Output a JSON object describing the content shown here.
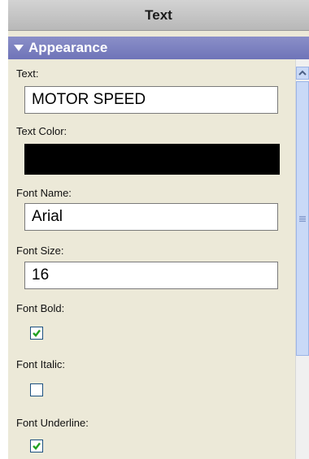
{
  "panel": {
    "title": "Text",
    "section": {
      "label": "Appearance",
      "expanded": true
    }
  },
  "fields": {
    "text": {
      "label": "Text:",
      "value": "MOTOR SPEED"
    },
    "text_color": {
      "label": "Text Color:",
      "value": "#000000"
    },
    "font_name": {
      "label": "Font Name:",
      "value": "Arial"
    },
    "font_size": {
      "label": "Font Size:",
      "value": "16"
    },
    "font_bold": {
      "label": "Font Bold:",
      "checked": true
    },
    "font_italic": {
      "label": "Font Italic:",
      "checked": false
    },
    "font_underline": {
      "label": "Font Underline:",
      "checked": true
    }
  },
  "colors": {
    "section_header": "#7a7fbf",
    "panel_background": "#ece9d8",
    "check_mark": "#21a121"
  }
}
